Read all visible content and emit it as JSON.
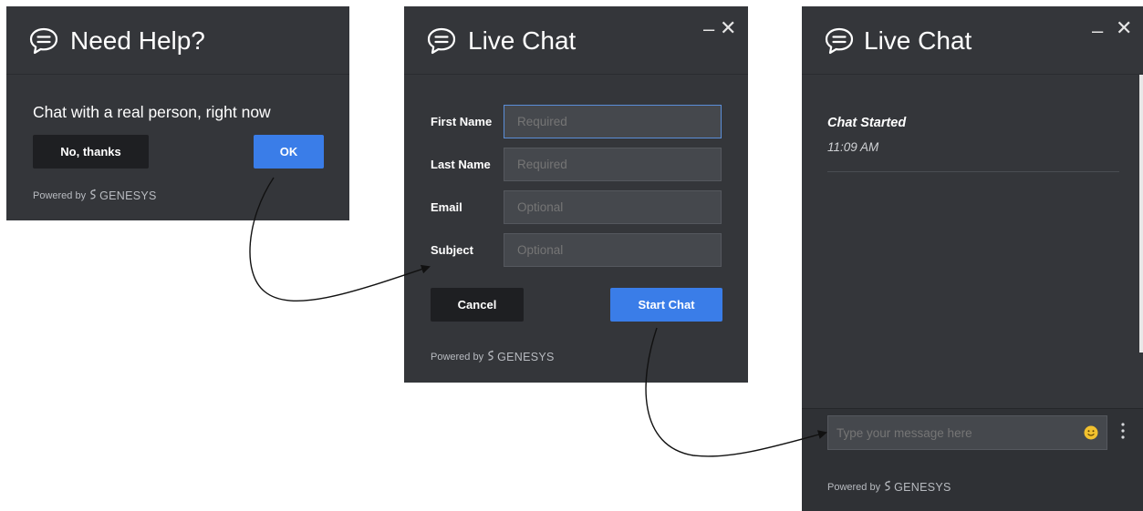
{
  "panel1": {
    "title": "Need Help?",
    "message": "Chat with a real person, right now",
    "no_label": "No, thanks",
    "ok_label": "OK",
    "powered_by": "Powered by",
    "brand": "GENESYS"
  },
  "panel2": {
    "title": "Live Chat",
    "fields": [
      {
        "label": "First Name",
        "placeholder": "Required"
      },
      {
        "label": "Last Name",
        "placeholder": "Required"
      },
      {
        "label": "Email",
        "placeholder": "Optional"
      },
      {
        "label": "Subject",
        "placeholder": "Optional"
      }
    ],
    "cancel_label": "Cancel",
    "start_label": "Start Chat",
    "powered_by": "Powered by",
    "brand": "GENESYS"
  },
  "panel3": {
    "title": "Live Chat",
    "chat_started": "Chat Started",
    "time": "11:09 AM",
    "input_placeholder": "Type your message here",
    "powered_by": "Powered by",
    "brand": "GENESYS"
  },
  "icons": {
    "chat": "chat-bubble-icon",
    "minimize": "minimize-icon",
    "close": "close-icon",
    "emoji": "smiley-icon",
    "menu": "more-vertical-icon",
    "brand_logo": "genesys-logo-icon"
  },
  "colors": {
    "panel_bg": "#34363a",
    "primary_button": "#3a7de8",
    "secondary_button": "#1e1f22",
    "input_bg": "#45484d",
    "focus_border": "#5b8ed8",
    "emoji": "#f2c12e"
  }
}
